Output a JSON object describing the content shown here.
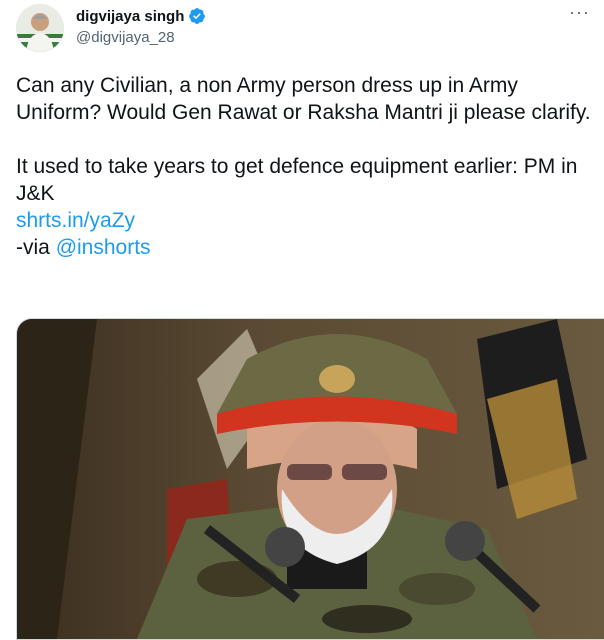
{
  "tweet": {
    "author_name": "digvijaya singh",
    "author_handle": "@digvijaya_28",
    "more_icon": "more-horizontal-icon",
    "verified_icon": "verified-badge-icon",
    "verified_color": "#1d9bf0",
    "text_line_1": "Can any Civilian, a non Army person dress up in Army Uniform? Would Gen Rawat or Raksha Mantri ji please clarify.",
    "text_line_2": "It used to take years to get defence equipment earlier: PM in J&K",
    "link_text": "shrts.in/yaZy",
    "via_prefix": "-via ",
    "via_mention": "@inshorts",
    "link_color": "#1d9bf0"
  }
}
